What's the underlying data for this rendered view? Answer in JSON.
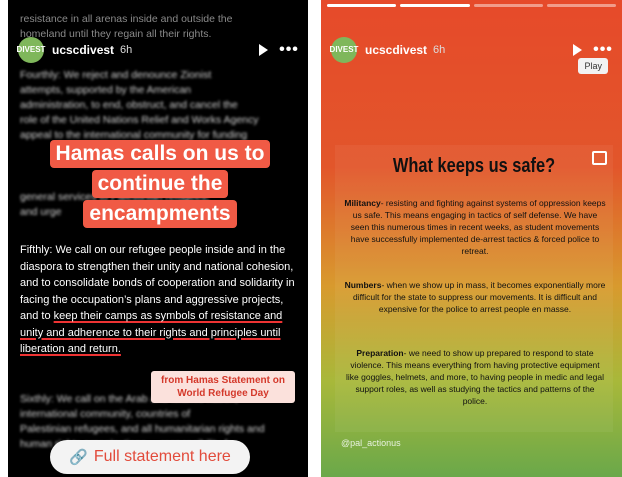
{
  "left_story": {
    "top_faded_1": "resistance in all arenas inside and outside the",
    "top_faded_2": "homeland until they regain all their rights.",
    "account": {
      "avatar_text": "DIVEST",
      "username": "ucscdivest",
      "age": "6h"
    },
    "fourthly_lines": [
      "Fourthly: We reject and denounce Zionist",
      "attempts, supported by the American",
      "administration, to end, obstruct, and cancel the",
      "role of the United Nations Relief and Works Agency",
      "appeal to the international community for funding",
      "general services to Palestinian refugees,",
      "and urge"
    ],
    "banner_lines": [
      "Hamas calls on us to",
      "continue the",
      "encampments"
    ],
    "fifthly_plain": "Fifthly: We call on our refugee people inside and in the diaspora to strengthen their unity and national cohesion, and to consolidate bonds of cooperation and solidarity in facing the occupation’s plans and aggressive projects, and to ",
    "fifthly_underlined": "keep their camps as symbols of resistance and unity and adherence to their rights and principles until liberation and return.",
    "sixthly_lines": [
      "Sixthly: We call on the Arab and Islamic nation,",
      "international community, countries of",
      "Palestinian refugees, and all humanitarian rights and",
      "human rights organizations ... responsibility for"
    ],
    "source_tag": "from Hamas Statement on World Refugee Day",
    "full_statement_label": "Full statement here"
  },
  "right_story": {
    "account": {
      "avatar_text": "DIVEST",
      "username": "ucscdivest",
      "age": "6h"
    },
    "play_label": "Play",
    "card_title": "What keeps us safe?",
    "sections": [
      {
        "term": "Militancy",
        "text": "- resisting and fighting against systems of oppression keeps us safe. This means engaging in tactics of self defense. We have seen this numerous times in recent weeks, as student movements have successfully implemented de-arrest tactics & forced police to retreat."
      },
      {
        "term": "Numbers",
        "text": "- when we show up in mass, it becomes exponentially more difficult for the state to suppress our movements. It is difficult and expensive for the police to arrest people en masse."
      },
      {
        "term": "Preparation",
        "text": "- we need to show up prepared to respond to state violence. This means everything from having protective equipment like goggles, helmets, and more, to having people in medic and legal support roles, as well as studying the tactics and patterns of the police."
      }
    ],
    "handle": "@pal_actionus"
  },
  "icons": [
    "play-icon",
    "more-options-icon",
    "link-icon",
    "sticker-icon"
  ]
}
